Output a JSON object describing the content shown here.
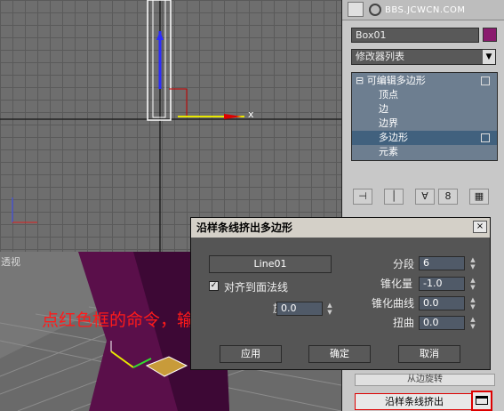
{
  "viewport_top": {
    "axis_x_label": "x"
  },
  "viewport_bottom": {
    "label": "透视"
  },
  "annotation": {
    "text": "点红色框的命令，输入参数",
    "color": "#ff1a1a"
  },
  "watermark": "BBS.JCWCN.COM",
  "panel": {
    "object_name": "Box01",
    "object_color": "#8a1a6e",
    "modifier_list": "修改器列表",
    "stack": {
      "root": "可编辑多边形",
      "items": [
        "顶点",
        "边",
        "边界",
        "多边形",
        "元素"
      ],
      "selected_index": 3
    },
    "bottom_buttons": [
      "从边旋转",
      "沿样条线挤出"
    ]
  },
  "dialog": {
    "title": "沿样条线挤出多边形",
    "close": "×",
    "spline_button": "Line01",
    "align_checkbox_label": "对齐到面法线",
    "align_checked": true,
    "rotation_label": "旋转",
    "rotation_value": "0.0",
    "segments_label": "分段",
    "segments_value": "6",
    "taper_label": "锥化量",
    "taper_value": "-1.0",
    "taper_curve_label": "锥化曲线",
    "taper_curve_value": "0.0",
    "twist_label": "扭曲",
    "twist_value": "0.0",
    "apply": "应用",
    "ok": "确定",
    "cancel": "取消"
  }
}
